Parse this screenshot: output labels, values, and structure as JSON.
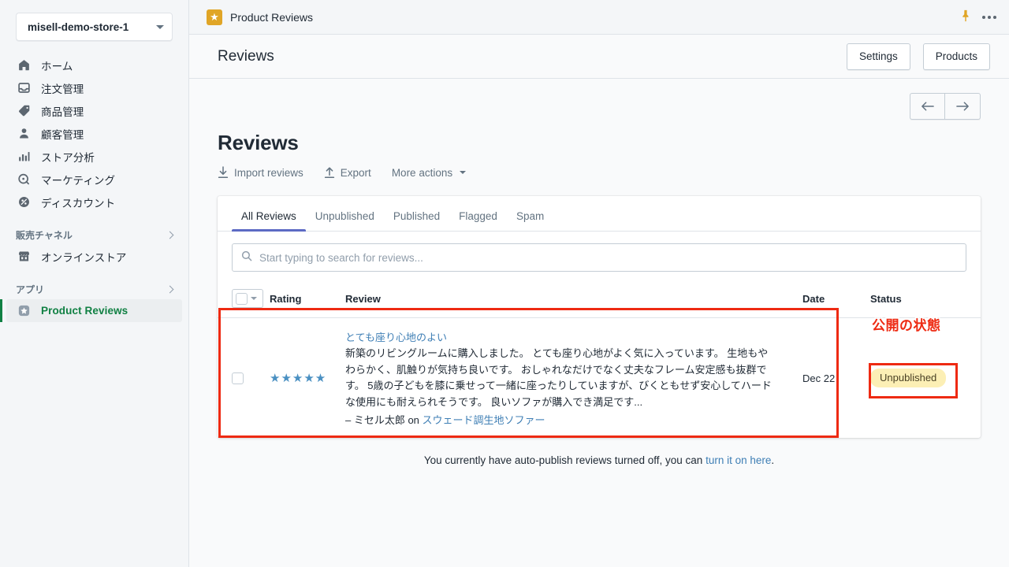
{
  "sidebar": {
    "store_selector": {
      "value": "misell-demo-store-1",
      "caret_icon": "chevron-down-icon"
    },
    "items": [
      {
        "label": "ホーム",
        "icon": "home-icon"
      },
      {
        "label": "注文管理",
        "icon": "orders-inbox-icon"
      },
      {
        "label": "商品管理",
        "icon": "product-tag-icon"
      },
      {
        "label": "顧客管理",
        "icon": "customer-person-icon"
      },
      {
        "label": "ストア分析",
        "icon": "analytics-bars-icon"
      },
      {
        "label": "マーケティング",
        "icon": "marketing-target-icon"
      },
      {
        "label": "ディスカウント",
        "icon": "discount-percent-icon"
      }
    ],
    "sections": [
      {
        "label": "販売チャネル",
        "chevron_icon": "chevron-right-icon"
      },
      {
        "label": "アプリ",
        "chevron_icon": "chevron-right-icon"
      }
    ],
    "channel_item": {
      "label": "オンラインストア",
      "icon": "online-store-icon"
    },
    "app_item": {
      "label": "Product Reviews",
      "icon": "star-badge-icon",
      "active": true
    }
  },
  "appbar": {
    "app_icon": "star-app-icon",
    "title": "Product Reviews",
    "pin_icon": "pushpin-icon",
    "more_icon": "ellipsis-icon"
  },
  "page_header": {
    "title": "Reviews",
    "settings_label": "Settings",
    "products_label": "Products"
  },
  "pagination": {
    "prev_icon": "arrow-left-icon",
    "next_icon": "arrow-right-icon"
  },
  "main": {
    "section_title": "Reviews",
    "actions": [
      {
        "label": "Import reviews",
        "icon": "download-arrow-icon"
      },
      {
        "label": "Export",
        "icon": "upload-arrow-icon"
      },
      {
        "label": "More actions",
        "icon": "chevron-down-icon"
      }
    ],
    "tabs": [
      {
        "label": "All Reviews",
        "active": true
      },
      {
        "label": "Unpublished",
        "active": false
      },
      {
        "label": "Published",
        "active": false
      },
      {
        "label": "Flagged",
        "active": false
      },
      {
        "label": "Spam",
        "active": false
      }
    ],
    "search": {
      "value": "",
      "placeholder": "Start typing to search for reviews...",
      "icon": "search-icon"
    },
    "table": {
      "columns": [
        "",
        "Rating",
        "Review",
        "Date",
        "Status"
      ],
      "rows": [
        {
          "checked": false,
          "rating": 5,
          "stars": "★★★★★",
          "title": "とても座り心地のよい",
          "body": "新築のリビングルームに購入しました。 とても座り心地がよく気に入っています。 生地もやわらかく、肌触りが気持ち良いです。 おしゃれなだけでなく丈夫なフレーム安定感も抜群です。 5歳の子どもを膝に乗せって一緒に座ったりしていますが、びくともせず安心してハードな使用にも耐えられそうです。 良いソファが購入でき満足です...",
          "author_prefix": "– ミセル太郎 on ",
          "product": "スウェード調生地ソファー",
          "date": "Dec 22",
          "status": "Unpublished"
        }
      ]
    },
    "footer_note": {
      "text": "You currently have auto-publish reviews turned off, you can ",
      "link": "turn it on here",
      "suffix": "."
    }
  },
  "annotations": {
    "status_label": "公開の状態",
    "highlight_color": "#ee2a12"
  }
}
